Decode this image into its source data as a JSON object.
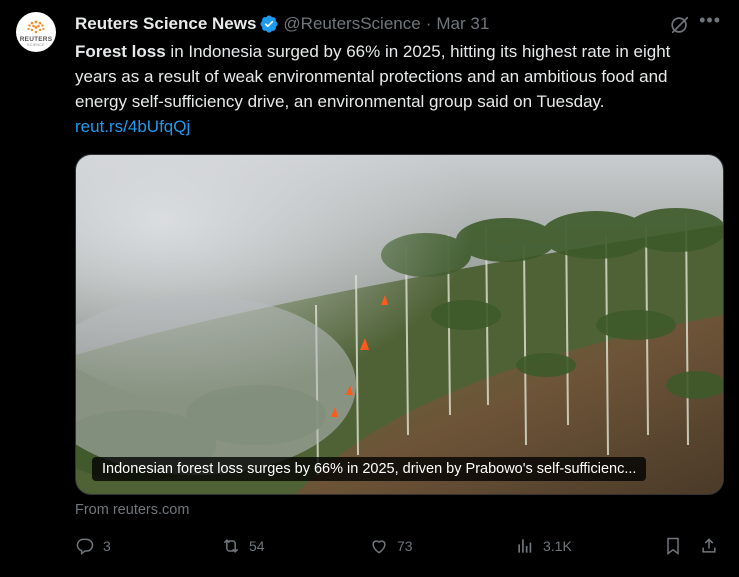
{
  "author": {
    "name": "Reuters Science News",
    "handle": "@ReutersScience",
    "date": "Mar 31",
    "avatar_brand": "REUTERS",
    "avatar_sub": "SCIENCE"
  },
  "tweet": {
    "bold_text": "Forest loss",
    "text": " in Indonesia surged by 66% in 2025, hitting its highest rate in eight years as a result of weak environmental protections and an ambitious food and energy self-sufficiency drive, an environmental group said on Tuesday. ",
    "link_text": "reut.rs/4bUfqQj"
  },
  "card": {
    "caption": "Indonesian forest loss surges by 66% in 2025, driven by Prabowo's self-sufficienc...",
    "source": "From reuters.com"
  },
  "actions": {
    "reply_count": "3",
    "repost_count": "54",
    "like_count": "73",
    "view_count": "3.1K"
  },
  "colors": {
    "background": "#000000",
    "text": "#e7e9ea",
    "muted": "#71767b",
    "link": "#1d9bf0",
    "verified": "#1d9bf0"
  },
  "icons": [
    "verified-badge-icon",
    "grok-icon",
    "more-icon",
    "reply-icon",
    "repost-icon",
    "like-icon",
    "views-icon",
    "bookmark-icon",
    "share-icon"
  ]
}
